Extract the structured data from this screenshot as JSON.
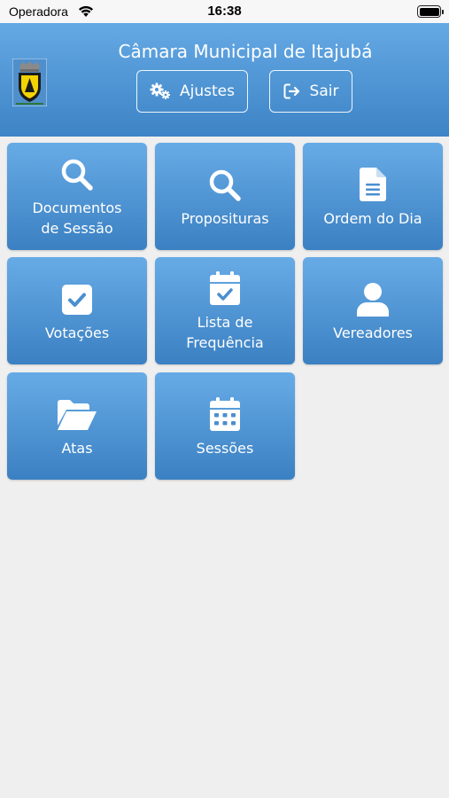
{
  "status_bar": {
    "carrier": "Operadora",
    "time": "16:38"
  },
  "header": {
    "title": "Câmara Municipal de Itajubá",
    "settings_label": "Ajustes",
    "logout_label": "Sair"
  },
  "tiles": [
    {
      "label_line1": "Documentos",
      "label_line2": "de Sessão",
      "icon": "search-icon"
    },
    {
      "label": "Proposituras",
      "icon": "search-icon"
    },
    {
      "label": "Ordem do Dia",
      "icon": "document-icon"
    },
    {
      "label": "Votações",
      "icon": "checkbox-icon"
    },
    {
      "label_line1": "Lista de",
      "label_line2": "Frequência",
      "icon": "calendar-check-icon"
    },
    {
      "label": "Vereadores",
      "icon": "user-icon"
    },
    {
      "label": "Atas",
      "icon": "folder-open-icon"
    },
    {
      "label": "Sessões",
      "icon": "calendar-icon"
    }
  ],
  "colors": {
    "header_top": "#65a9e4",
    "header_bottom": "#3d84c6",
    "tile_top": "#67abe6",
    "tile_bottom": "#3b80c2",
    "background": "#efefef"
  }
}
